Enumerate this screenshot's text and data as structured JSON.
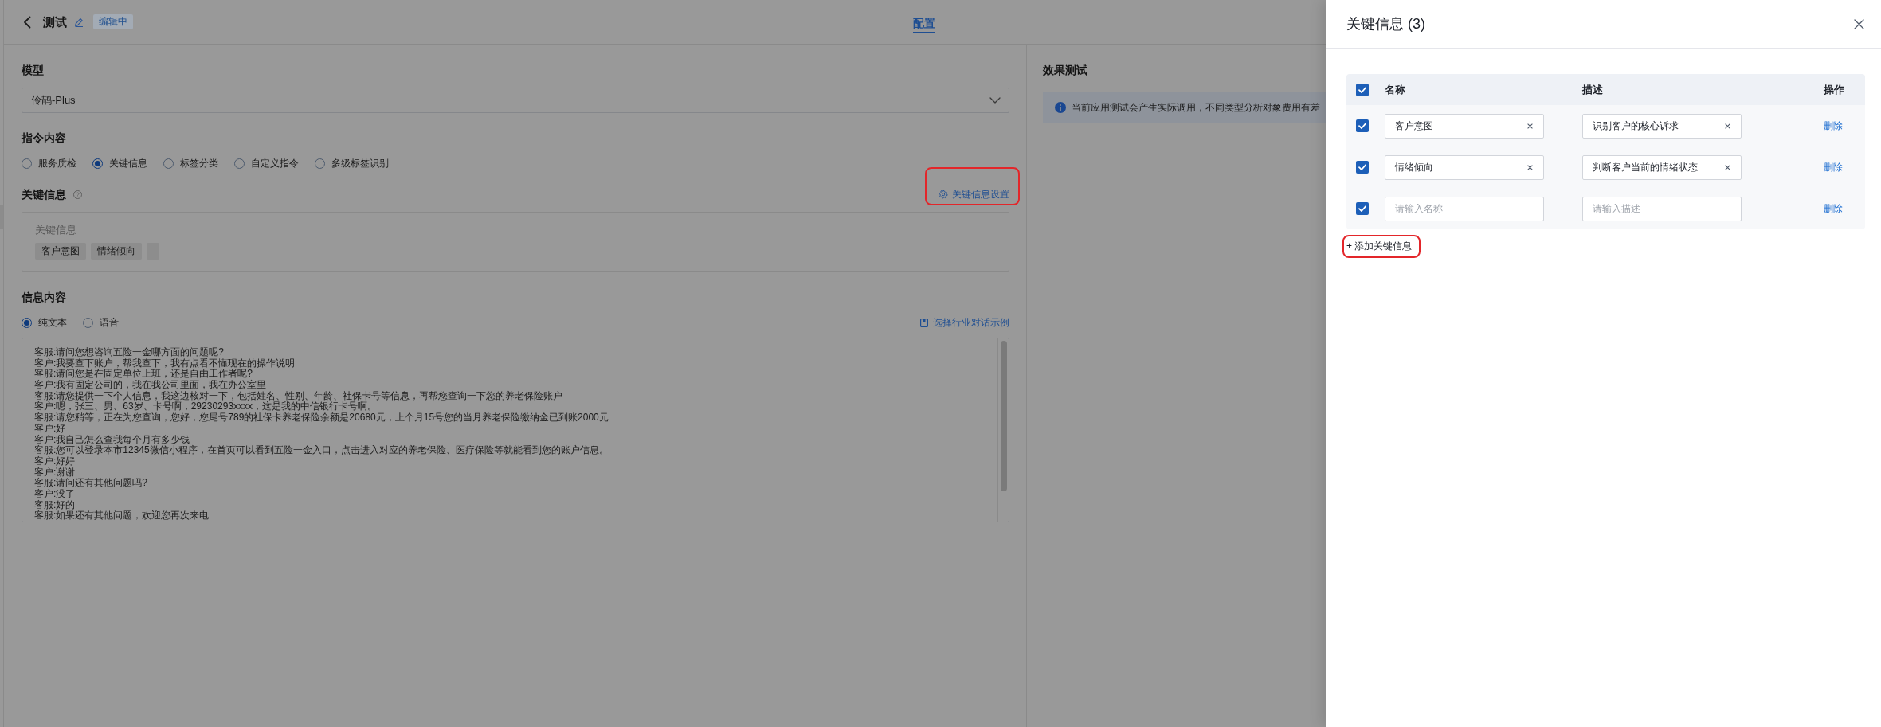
{
  "header": {
    "title": "测试",
    "badge": "编辑中",
    "tabs": [
      {
        "label": "配置",
        "selected": true
      }
    ]
  },
  "config": {
    "model": {
      "label": "模型",
      "value": "伶鹊-Plus"
    },
    "instruction": {
      "label": "指令内容",
      "options": [
        {
          "label": "服务质检",
          "selected": false
        },
        {
          "label": "关键信息",
          "selected": true
        },
        {
          "label": "标签分类",
          "selected": false
        },
        {
          "label": "自定义指令",
          "selected": false
        },
        {
          "label": "多级标签识别",
          "selected": false
        }
      ]
    },
    "key_info": {
      "label": "关键信息",
      "settings_link": {
        "label": "关键信息设置",
        "outlined": true
      },
      "box_label": "关键信息",
      "tags": [
        {
          "kind": "tag",
          "label": "客户意图"
        },
        {
          "kind": "tag",
          "label": "情绪倾向"
        },
        {
          "kind": "blank"
        }
      ]
    },
    "content": {
      "label": "信息内容",
      "options": [
        {
          "label": "纯文本",
          "selected": true
        },
        {
          "label": "语音",
          "selected": false
        }
      ],
      "example_link": "选择行业对话示例",
      "dialog": [
        "客服:请问您想咨询五险一金哪方面的问题呢?",
        "客户:我要查下账户，帮我查下，我有点看不懂现在的操作说明",
        "客服:请问您是在固定单位上班，还是自由工作者呢?",
        "客户:我有固定公司的，我在我公司里面，我在办公室里",
        "客服:请您提供一下个人信息，我这边核对一下，包括姓名、性别、年龄、社保卡号等信息，再帮您查询一下您的养老保险账户",
        "客户:嗯，张三、男、63岁、卡号啊，29230293xxxx，这是我的中信银行卡号啊。",
        "客服:请您稍等，正在为您查询，您好，您尾号789的社保卡养老保险余额是20680元，上个月15号您的当月养老保险缴纳金已到账2000元",
        "客户:好",
        "客户:我自己怎么查我每个月有多少钱",
        "客服:您可以登录本市12345微信小程序，在首页可以看到五险一金入口，点击进入对应的养老保险、医疗保险等就能看到您的账户信息。",
        "客户:好好",
        "客户:谢谢",
        "客服:请问还有其他问题吗?",
        "客户:没了",
        "客服:好的",
        "客服:如果还有其他问题，欢迎您再次来电"
      ]
    }
  },
  "test_panel": {
    "title": "效果测试",
    "notice": "当前应用测试会产生实际调用，不同类型分析对象费用有差"
  },
  "drawer": {
    "title": "关键信息 (3)",
    "select_all": {
      "checked": true
    },
    "columns": [
      "名称",
      "描述",
      "操作"
    ],
    "rows": [
      {
        "checked": true,
        "name": {
          "value": "客户意图"
        },
        "description": {
          "value": "识别客户的核心诉求"
        },
        "action": "删除"
      },
      {
        "checked": true,
        "name": {
          "value": "情绪倾向"
        },
        "description": {
          "value": "判断客户当前的情绪状态"
        },
        "action": "删除"
      },
      {
        "checked": true,
        "name": {
          "placeholder": "请输入名称"
        },
        "description": {
          "placeholder": "请输入描述"
        },
        "action": "删除"
      }
    ],
    "add_button": {
      "label": "+ 添加关键信息",
      "outlined": true
    }
  }
}
